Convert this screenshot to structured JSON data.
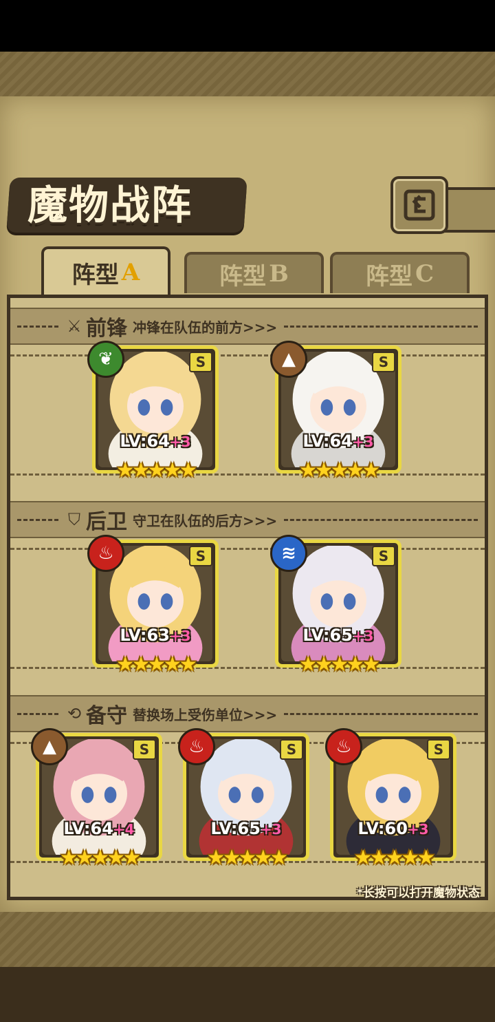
{
  "title": "魔物战阵",
  "tabs": [
    {
      "label": "阵型",
      "suffix": "A",
      "active": true
    },
    {
      "label": "阵型",
      "suffix": "B",
      "active": false
    },
    {
      "label": "阵型",
      "suffix": "C",
      "active": false
    }
  ],
  "sections": {
    "front": {
      "title": "前锋",
      "desc": "冲锋在队伍的前方>>>",
      "icon": "sword-icon"
    },
    "back": {
      "title": "后卫",
      "desc": "守卫在队伍的后方>>>",
      "icon": "shield-icon"
    },
    "reserve": {
      "title": "备守",
      "desc": "替换场上受伤单位>>>",
      "icon": "swap-icon"
    }
  },
  "cards": {
    "front": [
      {
        "rank": "S",
        "element": "leaf",
        "elem_color": "#3d8a2e",
        "elem_glyph": "❦",
        "lv": "LV:64",
        "plus": "+3",
        "stars": "★★★★★",
        "hair": "#f4d892",
        "outfit": "#f3eee2"
      },
      {
        "rank": "S",
        "element": "earth",
        "elem_color": "#8a5a2e",
        "elem_glyph": "▲",
        "lv": "LV:64",
        "plus": "+3",
        "stars": "★★★★★",
        "hair": "#f6f4f0",
        "outfit": "#d8d6d2"
      }
    ],
    "back": [
      {
        "rank": "S",
        "element": "fire",
        "elem_color": "#c8221c",
        "elem_glyph": "♨",
        "lv": "LV:63",
        "plus": "+3",
        "stars": "★★★★★",
        "hair": "#f4d37a",
        "outfit": "#f19bc4"
      },
      {
        "rank": "S",
        "element": "water",
        "elem_color": "#2a66c7",
        "elem_glyph": "≋",
        "lv": "LV:65",
        "plus": "+3",
        "stars": "★★★★★",
        "hair": "#ece8f0",
        "outfit": "#d98bbd"
      }
    ],
    "reserve": [
      {
        "rank": "S",
        "element": "earth",
        "elem_color": "#8a5a2e",
        "elem_glyph": "▲",
        "lv": "LV:64",
        "plus": "+4",
        "stars": "★★★★★",
        "hair": "#e9a7b3",
        "outfit": "#f3ece0"
      },
      {
        "rank": "S",
        "element": "fire",
        "elem_color": "#c8221c",
        "elem_glyph": "♨",
        "lv": "LV:65",
        "plus": "+3",
        "stars": "★★★★★",
        "hair": "#dfe6f2",
        "outfit": "#b13333"
      },
      {
        "rank": "S",
        "element": "fire",
        "elem_color": "#c8221c",
        "elem_glyph": "♨",
        "lv": "LV:60",
        "plus": "+3",
        "stars": "★★★★★",
        "hair": "#f1cc62",
        "outfit": "#2d2b37"
      }
    ]
  },
  "hint": "*长按可以打开魔物状态"
}
